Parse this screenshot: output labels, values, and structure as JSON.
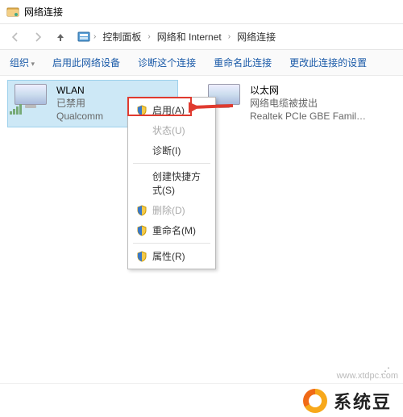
{
  "window": {
    "title": "网络连接"
  },
  "nav": {
    "breadcrumb": [
      "控制面板",
      "网络和 Internet",
      "网络连接"
    ]
  },
  "toolbar": {
    "organize": "组织",
    "enable_device": "启用此网络设备",
    "diagnose": "诊断这个连接",
    "rename": "重命名此连接",
    "change_settings": "更改此连接的设置"
  },
  "adapters": [
    {
      "name": "WLAN",
      "status": "已禁用",
      "vendor": "Qualcomm",
      "selected": true,
      "type": "wlan"
    },
    {
      "name": "以太网",
      "status": "网络电缆被拔出",
      "vendor": "Realtek PCIe GBE Family...",
      "selected": false,
      "type": "eth"
    }
  ],
  "context_menu": {
    "items": [
      {
        "label": "启用(A)",
        "shield": true,
        "disabled": false,
        "highlighted": true
      },
      {
        "label": "状态(U)",
        "shield": false,
        "disabled": true
      },
      {
        "label": "诊断(I)",
        "shield": false,
        "disabled": false
      },
      {
        "sep": true
      },
      {
        "label": "创建快捷方式(S)",
        "shield": false,
        "disabled": false
      },
      {
        "label": "删除(D)",
        "shield": true,
        "disabled": true
      },
      {
        "label": "重命名(M)",
        "shield": true,
        "disabled": false
      },
      {
        "sep": true
      },
      {
        "label": "属性(R)",
        "shield": true,
        "disabled": false
      }
    ]
  },
  "footer": {
    "brand": "系统豆",
    "watermark": "www.xtdpc.com"
  },
  "colors": {
    "highlight_border": "#e03a2f",
    "arrow": "#e03a2f",
    "selection": "#cde8f6"
  }
}
